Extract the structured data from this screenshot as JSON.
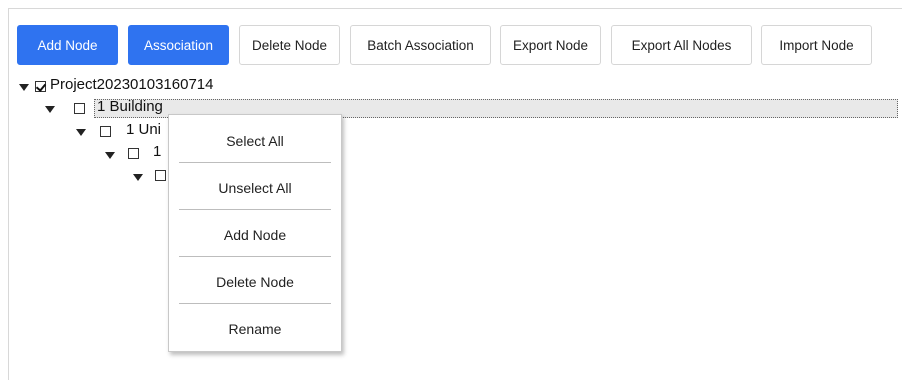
{
  "toolbar": {
    "add_node": "Add Node",
    "association": "Association",
    "delete_node": "Delete Node",
    "batch_association": "Batch Association",
    "export_node": "Export Node",
    "export_all_nodes": "Export All Nodes",
    "import_node": "Import Node"
  },
  "tree": {
    "project": {
      "label": "Project20230103160714",
      "checked": true
    },
    "building": {
      "label": "1 Building",
      "checked": false
    },
    "unit": {
      "label": "1 Uni",
      "checked": false
    },
    "level3": {
      "label": "1",
      "checked": false
    },
    "level4": {
      "label": "",
      "checked": false
    }
  },
  "context_menu": {
    "items": [
      "Select All",
      "Unselect All",
      "Add Node",
      "Delete Node",
      "Rename"
    ]
  },
  "colors": {
    "primary_button": "#2f73f0",
    "selected_row": "#e9e9e9",
    "border": "#d6d6d6"
  }
}
